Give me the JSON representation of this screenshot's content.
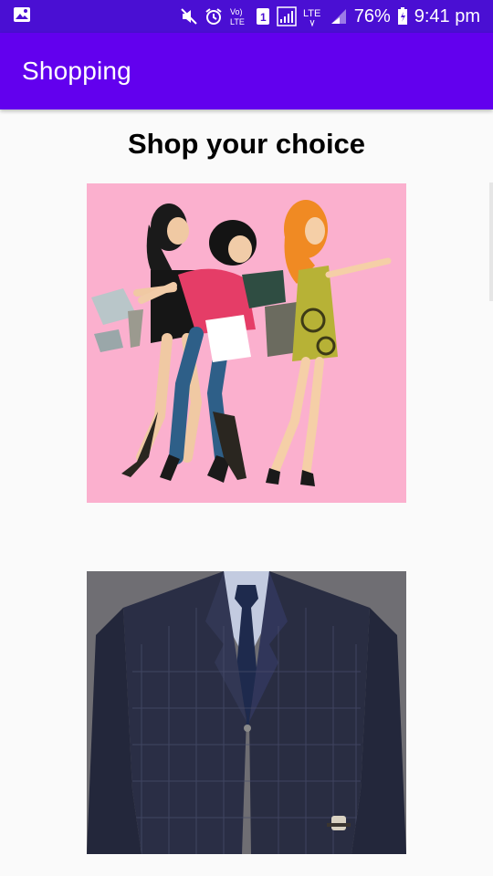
{
  "status_bar": {
    "battery": "76%",
    "time": "9:41 pm",
    "icons": [
      "gallery-icon",
      "mute-icon",
      "alarm-icon",
      "volte-icon",
      "sim1-icon",
      "signal-r-icon",
      "lte-icon",
      "signal-icon",
      "battery-icon"
    ]
  },
  "app_bar": {
    "title": "Shopping"
  },
  "content": {
    "heading": "Shop your choice",
    "products": [
      {
        "name": "shopping-girls-illustration"
      },
      {
        "name": "mens-suit-photo"
      }
    ]
  },
  "colors": {
    "status_bar": "#4a0fd3",
    "app_bar": "#6200ee",
    "background": "#fafafa",
    "image1_bg": "#fbb0ce",
    "image2_bg": "#6f6e73"
  }
}
